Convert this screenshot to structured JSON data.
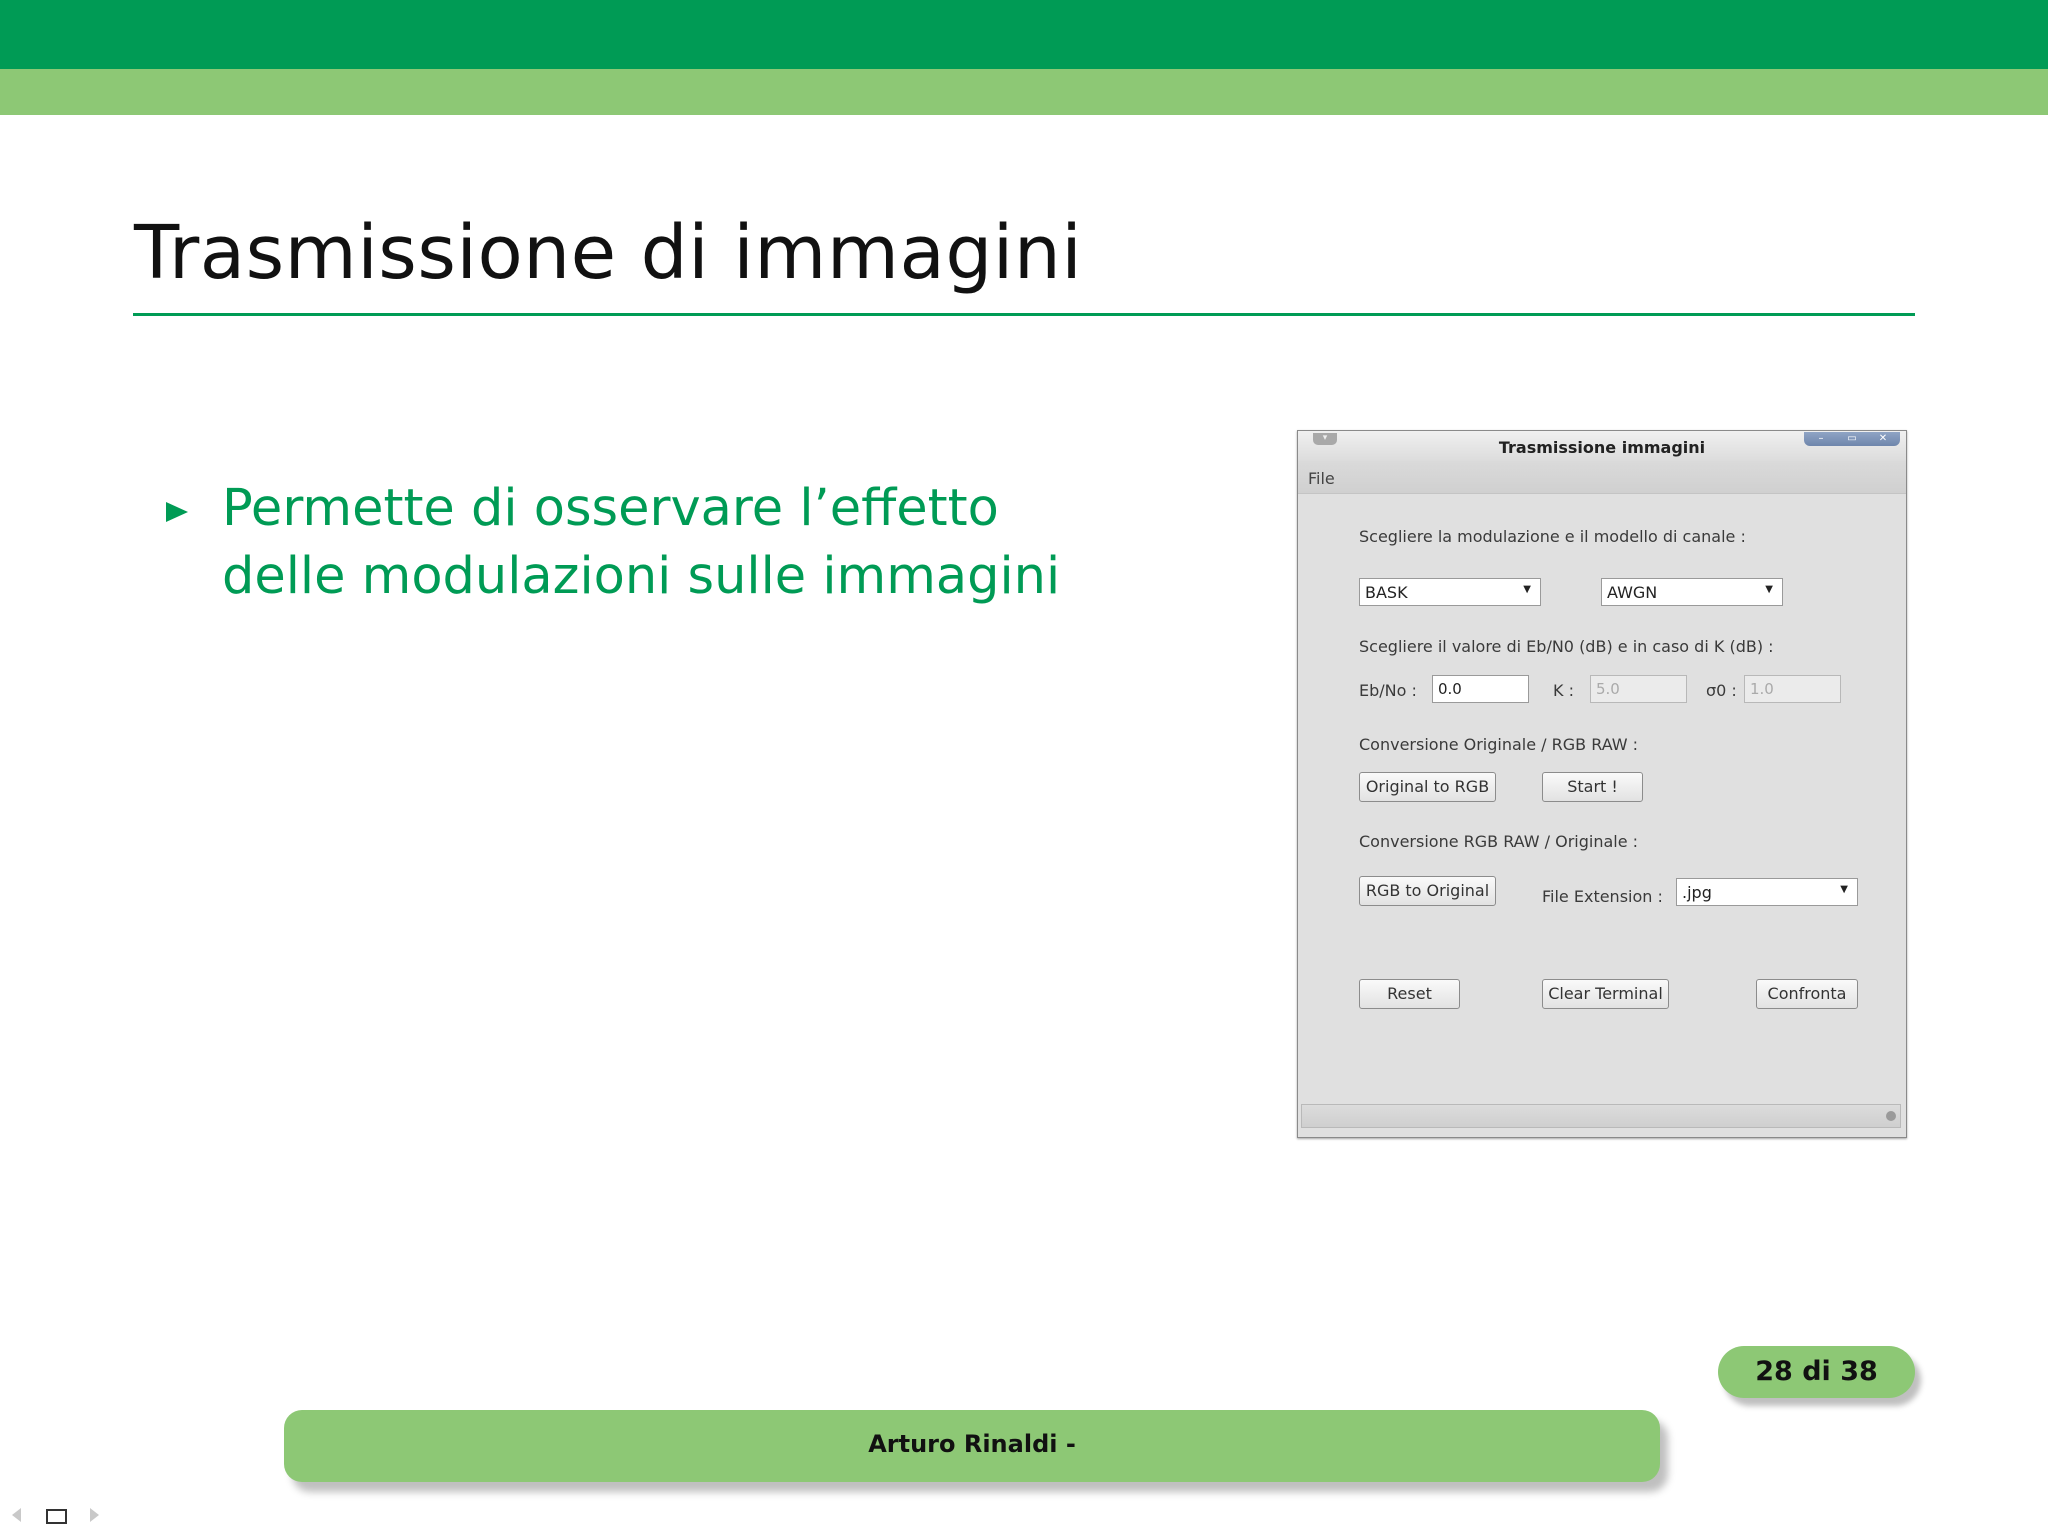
{
  "slide": {
    "title": "Trasmissione di immagini",
    "bullet": "Permette di osservare l’effetto delle modulazioni sulle immagini",
    "page_number": "28 di 38",
    "footer_author": "Arturo Rinaldi -"
  },
  "window": {
    "title": "Trasmissione immagini",
    "menu_button_glyph": "▾",
    "controls": {
      "minimize": "–",
      "maximize": "▭",
      "close": "✕"
    },
    "menu": {
      "file": "File"
    },
    "section_modulation_label": "Scegliere la modulazione e il modello di canale :",
    "modulation_select": {
      "value": "BASK"
    },
    "channel_select": {
      "value": "AWGN"
    },
    "section_ebno_label": "Scegliere il valore di Eb/N0 (dB) e in caso di K (dB) :",
    "ebno": {
      "label": "Eb/No :",
      "value": "0.0"
    },
    "k": {
      "label": "K :",
      "value": "5.0"
    },
    "sigma0": {
      "label": "σ0 :",
      "value": "1.0"
    },
    "section_orig_rgb_label": "Conversione Originale / RGB RAW :",
    "original_to_rgb_button": "Original to RGB",
    "start_button": "Start !",
    "section_rgb_orig_label": "Conversione RGB RAW / Originale :",
    "rgb_to_original_button": "RGB to Original",
    "file_extension": {
      "label": "File Extension :",
      "value": ".jpg"
    },
    "reset_button": "Reset",
    "clear_terminal_button": "Clear Terminal",
    "confronta_button": "Confronta"
  },
  "colors": {
    "accent_green": "#009b55",
    "light_green": "#8dc875"
  },
  "icons": {
    "bullet": "triangle-bullet-icon",
    "dropdown": "dropdown-arrow-icon",
    "nav": [
      "nav-left-arrow-icon",
      "nav-frame-icon",
      "nav-right-arrow-icon"
    ]
  }
}
